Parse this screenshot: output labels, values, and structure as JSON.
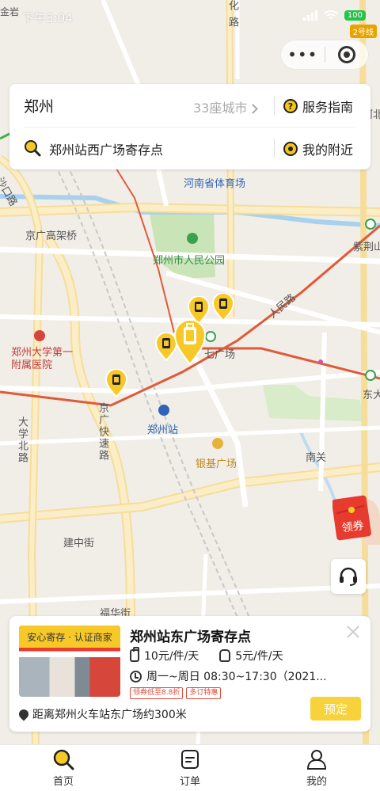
{
  "status_bar": {
    "time": "下午3:04",
    "battery": "100"
  },
  "capsule": {
    "more_icon": "more-dots-icon",
    "close_icon": "target-icon"
  },
  "metro_badge": "2号线",
  "search": {
    "city": "郑州",
    "city_count": "33座城市",
    "service_guide": "服务指南",
    "keyword": "郑州站西广场寄存点",
    "nearby": "我的附近"
  },
  "map_labels": {
    "district_top": "化 路",
    "north_label": "金岩",
    "river_label": "河北",
    "stadium": "河南省体育场",
    "shakou_road": "沙口路",
    "jingguang_bridge": "京广高架桥",
    "peoples_park": "郑州市人民公园",
    "zijingshan": "紫荆山",
    "renmin_road": "人民路",
    "hospital": "郑州大学第一附属医院",
    "square_partial": "七广场",
    "dongda": "东大",
    "jingguang_expressway": "京广快速路",
    "zhengzhou_station": "郑州站",
    "daxue_north": "大学北路",
    "yinji_square": "银基广场",
    "nanguan": "南关",
    "jianzhong_street": "建中街",
    "fuhua_street": "福华街"
  },
  "coupon": {
    "label": "领券"
  },
  "card": {
    "thumb_label": "安心寄存 · 认证商家",
    "title": "郑州站东广场寄存点",
    "price_bag": "10元/件/天",
    "price_pack": "5元/件/天",
    "hours": "周一~周日 08:30~17:30（2021...",
    "tags": [
      "领券低至8.8折",
      "多订特惠"
    ],
    "distance": "距离郑州火车站东广场约300米",
    "book": "预定"
  },
  "tabs": [
    {
      "label": "首页"
    },
    {
      "label": "订单"
    },
    {
      "label": "我的"
    }
  ],
  "colors": {
    "accent_yellow": "#f7d23b",
    "route_red": "#e05a3a",
    "park_green": "#c9e5b8",
    "water_blue": "#9fcbea"
  }
}
